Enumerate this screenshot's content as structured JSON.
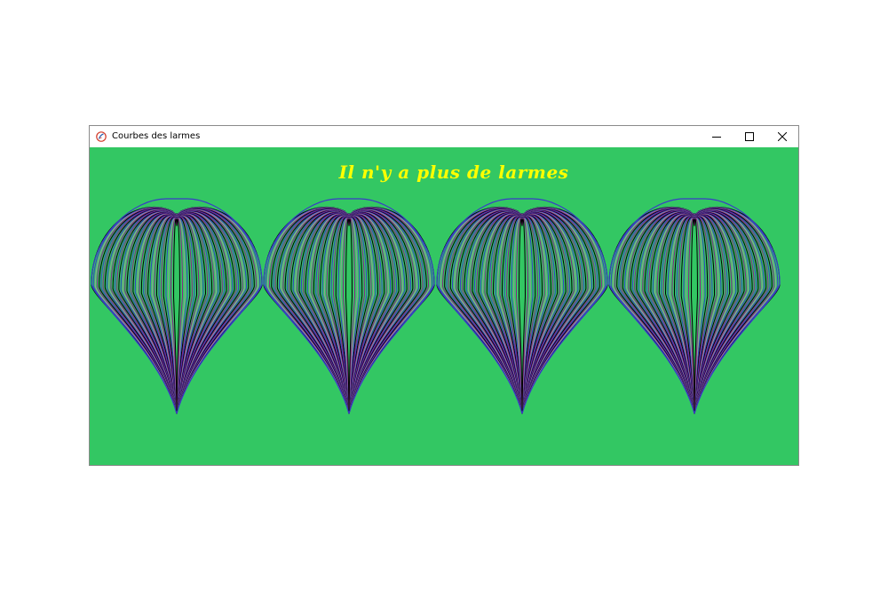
{
  "window": {
    "title": "Courbes des larmes",
    "app_icon": "tk-feather-icon",
    "controls": {
      "minimize_icon": "minimize-icon",
      "maximize_icon": "maximize-icon",
      "close_icon": "close-icon"
    }
  },
  "canvas": {
    "background_color": "#33c763",
    "caption": "Il n'y a plus de larmes",
    "caption_color": "#ffff00",
    "drop_count": 4,
    "curves_per_drop": 40,
    "curve_colors": [
      "#3a3ac8",
      "#000000",
      "#8b1f8b",
      "#9a9a9a",
      "#3a3ac8",
      "#000000",
      "#8b1f8b"
    ]
  }
}
